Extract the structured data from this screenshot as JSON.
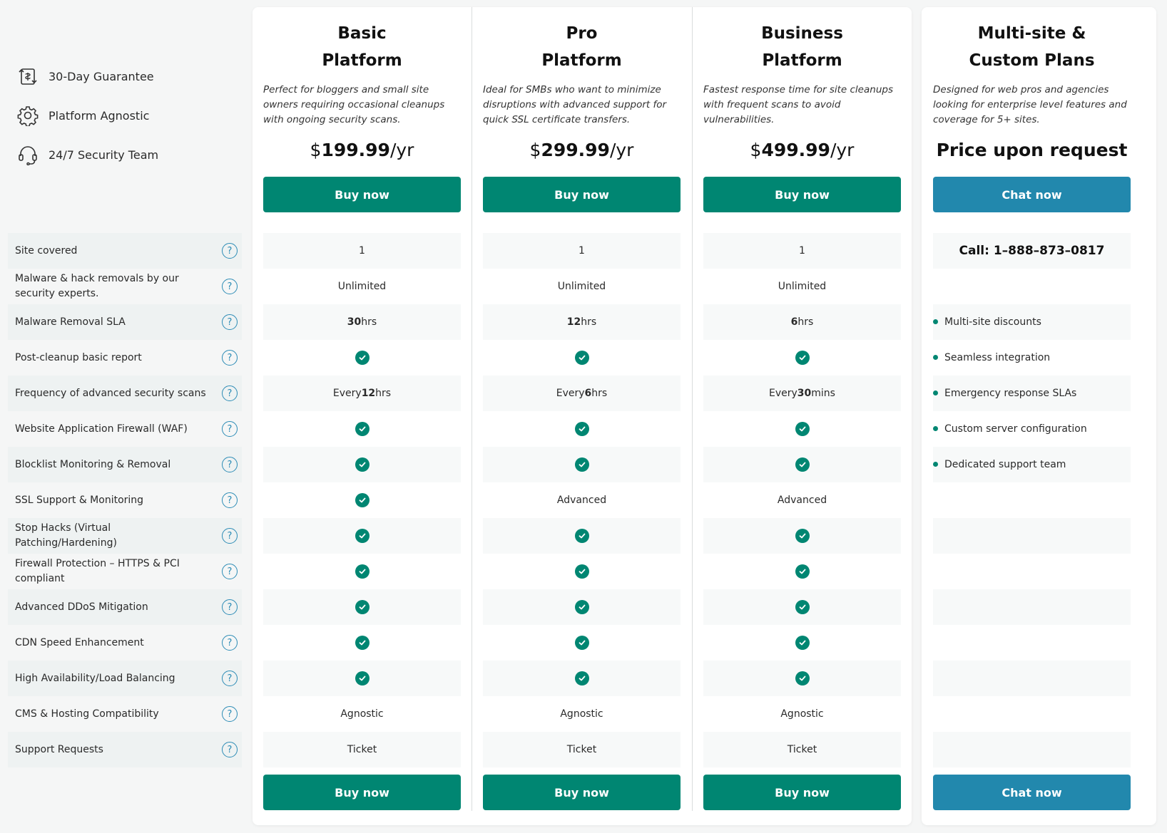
{
  "features": [
    {
      "icon": "refund-icon",
      "label": "30-Day Guarantee"
    },
    {
      "icon": "gear-icon",
      "label": "Platform Agnostic"
    },
    {
      "icon": "headset-icon",
      "label": "24/7 Security Team"
    }
  ],
  "rows": [
    "Site covered",
    "Malware & hack removals by our security experts.",
    "Malware Removal SLA",
    "Post-cleanup basic report",
    "Frequency of advanced security scans",
    "Website Application Firewall (WAF)",
    "Blocklist Monitoring & Removal",
    "SSL Support & Monitoring",
    "Stop Hacks (Virtual Patching/Hardening)",
    "Firewall Protection – HTTPS & PCI compliant",
    "Advanced DDoS Mitigation",
    "CDN Speed Enhancement",
    "High Availability/Load Balancing",
    "CMS & Hosting Compatibility",
    "Support Requests"
  ],
  "help_icon_glyph": "?",
  "plans": [
    {
      "title_line1": "Basic",
      "title_line2": "Platform",
      "description": "Perfect for bloggers and small site owners requiring occasional cleanups with ongoing security scans.",
      "price_symbol": "$",
      "price_amount": "199.99",
      "price_period": "/yr",
      "button_label": "Buy now",
      "cells": [
        {
          "text": "1"
        },
        {
          "text": "Unlimited"
        },
        {
          "bold": "30",
          "suffix": " hrs"
        },
        {
          "check": true
        },
        {
          "prefix": "Every ",
          "bold": "12",
          "suffix": " hrs"
        },
        {
          "check": true
        },
        {
          "check": true
        },
        {
          "check": true
        },
        {
          "check": true
        },
        {
          "check": true
        },
        {
          "check": true
        },
        {
          "check": true
        },
        {
          "check": true
        },
        {
          "text": "Agnostic"
        },
        {
          "text": "Ticket"
        }
      ]
    },
    {
      "title_line1": "Pro",
      "title_line2": "Platform",
      "description": "Ideal for SMBs who want to minimize disruptions with advanced support for quick SSL certificate transfers.",
      "price_symbol": "$",
      "price_amount": "299.99",
      "price_period": "/yr",
      "button_label": "Buy now",
      "cells": [
        {
          "text": "1"
        },
        {
          "text": "Unlimited"
        },
        {
          "bold": "12",
          "suffix": " hrs"
        },
        {
          "check": true
        },
        {
          "prefix": "Every ",
          "bold": "6",
          "suffix": " hrs"
        },
        {
          "check": true
        },
        {
          "check": true
        },
        {
          "text": "Advanced"
        },
        {
          "check": true
        },
        {
          "check": true
        },
        {
          "check": true
        },
        {
          "check": true
        },
        {
          "check": true
        },
        {
          "text": "Agnostic"
        },
        {
          "text": "Ticket"
        }
      ]
    },
    {
      "title_line1": "Business",
      "title_line2": "Platform",
      "description": "Fastest response time for site cleanups with frequent scans to avoid vulnerabilities.",
      "price_symbol": "$",
      "price_amount": "499.99",
      "price_period": "/yr",
      "button_label": "Buy now",
      "cells": [
        {
          "text": "1"
        },
        {
          "text": "Unlimited"
        },
        {
          "bold": "6",
          "suffix": " hrs"
        },
        {
          "check": true
        },
        {
          "prefix": "Every ",
          "bold": "30",
          "suffix": " mins"
        },
        {
          "check": true
        },
        {
          "check": true
        },
        {
          "text": "Advanced"
        },
        {
          "check": true
        },
        {
          "check": true
        },
        {
          "check": true
        },
        {
          "check": true
        },
        {
          "check": true
        },
        {
          "text": "Agnostic"
        },
        {
          "text": "Ticket"
        }
      ]
    }
  ],
  "custom_plan": {
    "title_line1": "Multi-site &",
    "title_line2": "Custom Plans",
    "description": "Designed for web pros and agencies looking for enterprise level features and coverage for 5+ sites.",
    "price_text": "Price upon request",
    "button_label": "Chat now",
    "call_text": "Call: 1–888–873–0817",
    "bullets": [
      "Multi-site discounts",
      "Seamless integration",
      "Emergency response SLAs",
      "Custom server configuration",
      "Dedicated support team"
    ]
  },
  "colors": {
    "accent_green": "#008672",
    "accent_blue": "#2288ad",
    "help_blue": "#2b8bb5"
  }
}
